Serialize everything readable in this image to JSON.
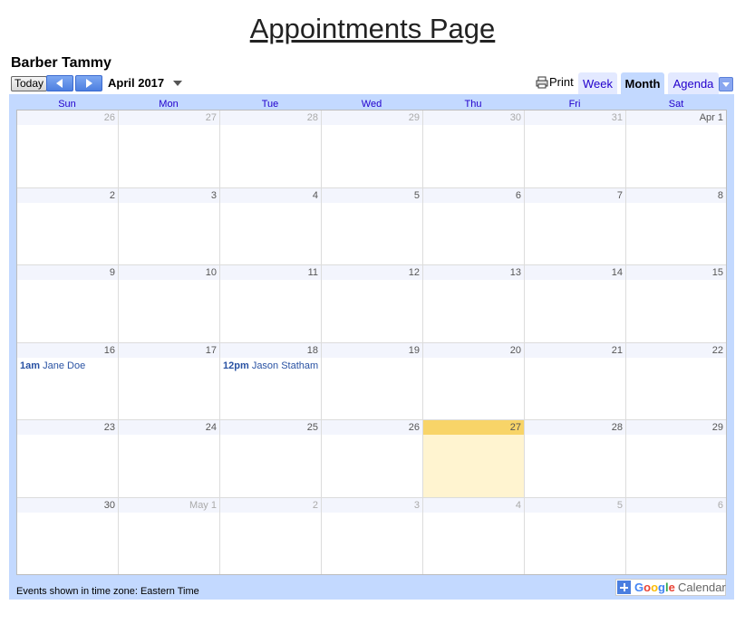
{
  "page": {
    "title": "Appointments Page"
  },
  "calendar": {
    "title": "Barber Tammy",
    "today_label": "Today",
    "date_label": "April 2017",
    "print_label": "Print",
    "tabs": [
      {
        "label": "Week"
      },
      {
        "label": "Month"
      },
      {
        "label": "Agenda"
      }
    ],
    "weekdays": [
      "Sun",
      "Mon",
      "Tue",
      "Wed",
      "Thu",
      "Fri",
      "Sat"
    ],
    "weeks": [
      {
        "days": [
          {
            "label": "26",
            "other": true
          },
          {
            "label": "27",
            "other": true
          },
          {
            "label": "28",
            "other": true
          },
          {
            "label": "29",
            "other": true
          },
          {
            "label": "30",
            "other": true
          },
          {
            "label": "31",
            "other": true
          },
          {
            "label": "Apr 1"
          }
        ]
      },
      {
        "days": [
          {
            "label": "2"
          },
          {
            "label": "3"
          },
          {
            "label": "4"
          },
          {
            "label": "5"
          },
          {
            "label": "6"
          },
          {
            "label": "7"
          },
          {
            "label": "8"
          }
        ]
      },
      {
        "days": [
          {
            "label": "9"
          },
          {
            "label": "10"
          },
          {
            "label": "11"
          },
          {
            "label": "12"
          },
          {
            "label": "13"
          },
          {
            "label": "14"
          },
          {
            "label": "15"
          }
        ]
      },
      {
        "days": [
          {
            "label": "16",
            "events": [
              {
                "time": "1am",
                "title": "Jane Doe"
              }
            ]
          },
          {
            "label": "17"
          },
          {
            "label": "18",
            "events": [
              {
                "time": "12pm",
                "title": "Jason Statham"
              }
            ]
          },
          {
            "label": "19"
          },
          {
            "label": "20"
          },
          {
            "label": "21"
          },
          {
            "label": "22"
          }
        ]
      },
      {
        "days": [
          {
            "label": "23"
          },
          {
            "label": "24"
          },
          {
            "label": "25"
          },
          {
            "label": "26"
          },
          {
            "label": "27",
            "today": true
          },
          {
            "label": "28"
          },
          {
            "label": "29"
          }
        ]
      },
      {
        "days": [
          {
            "label": "30"
          },
          {
            "label": "May 1",
            "other": true
          },
          {
            "label": "2",
            "other": true
          },
          {
            "label": "3",
            "other": true
          },
          {
            "label": "4",
            "other": true
          },
          {
            "label": "5",
            "other": true
          },
          {
            "label": "6",
            "other": true
          }
        ]
      }
    ],
    "timezone_text": "Events shown in time zone: Eastern Time",
    "badge": {
      "google": "Google",
      "word": "Calendar"
    }
  },
  "colors": {
    "accent": "#c3d9ff",
    "today": "#fff4d0",
    "today_header": "#f8d468",
    "event": "#2952a3",
    "link": "#2200cc"
  },
  "icons": {
    "prev": "chevron-left-icon",
    "next": "chevron-right-icon",
    "print": "printer-icon",
    "menu": "chevron-down-icon",
    "add": "plus-icon"
  }
}
